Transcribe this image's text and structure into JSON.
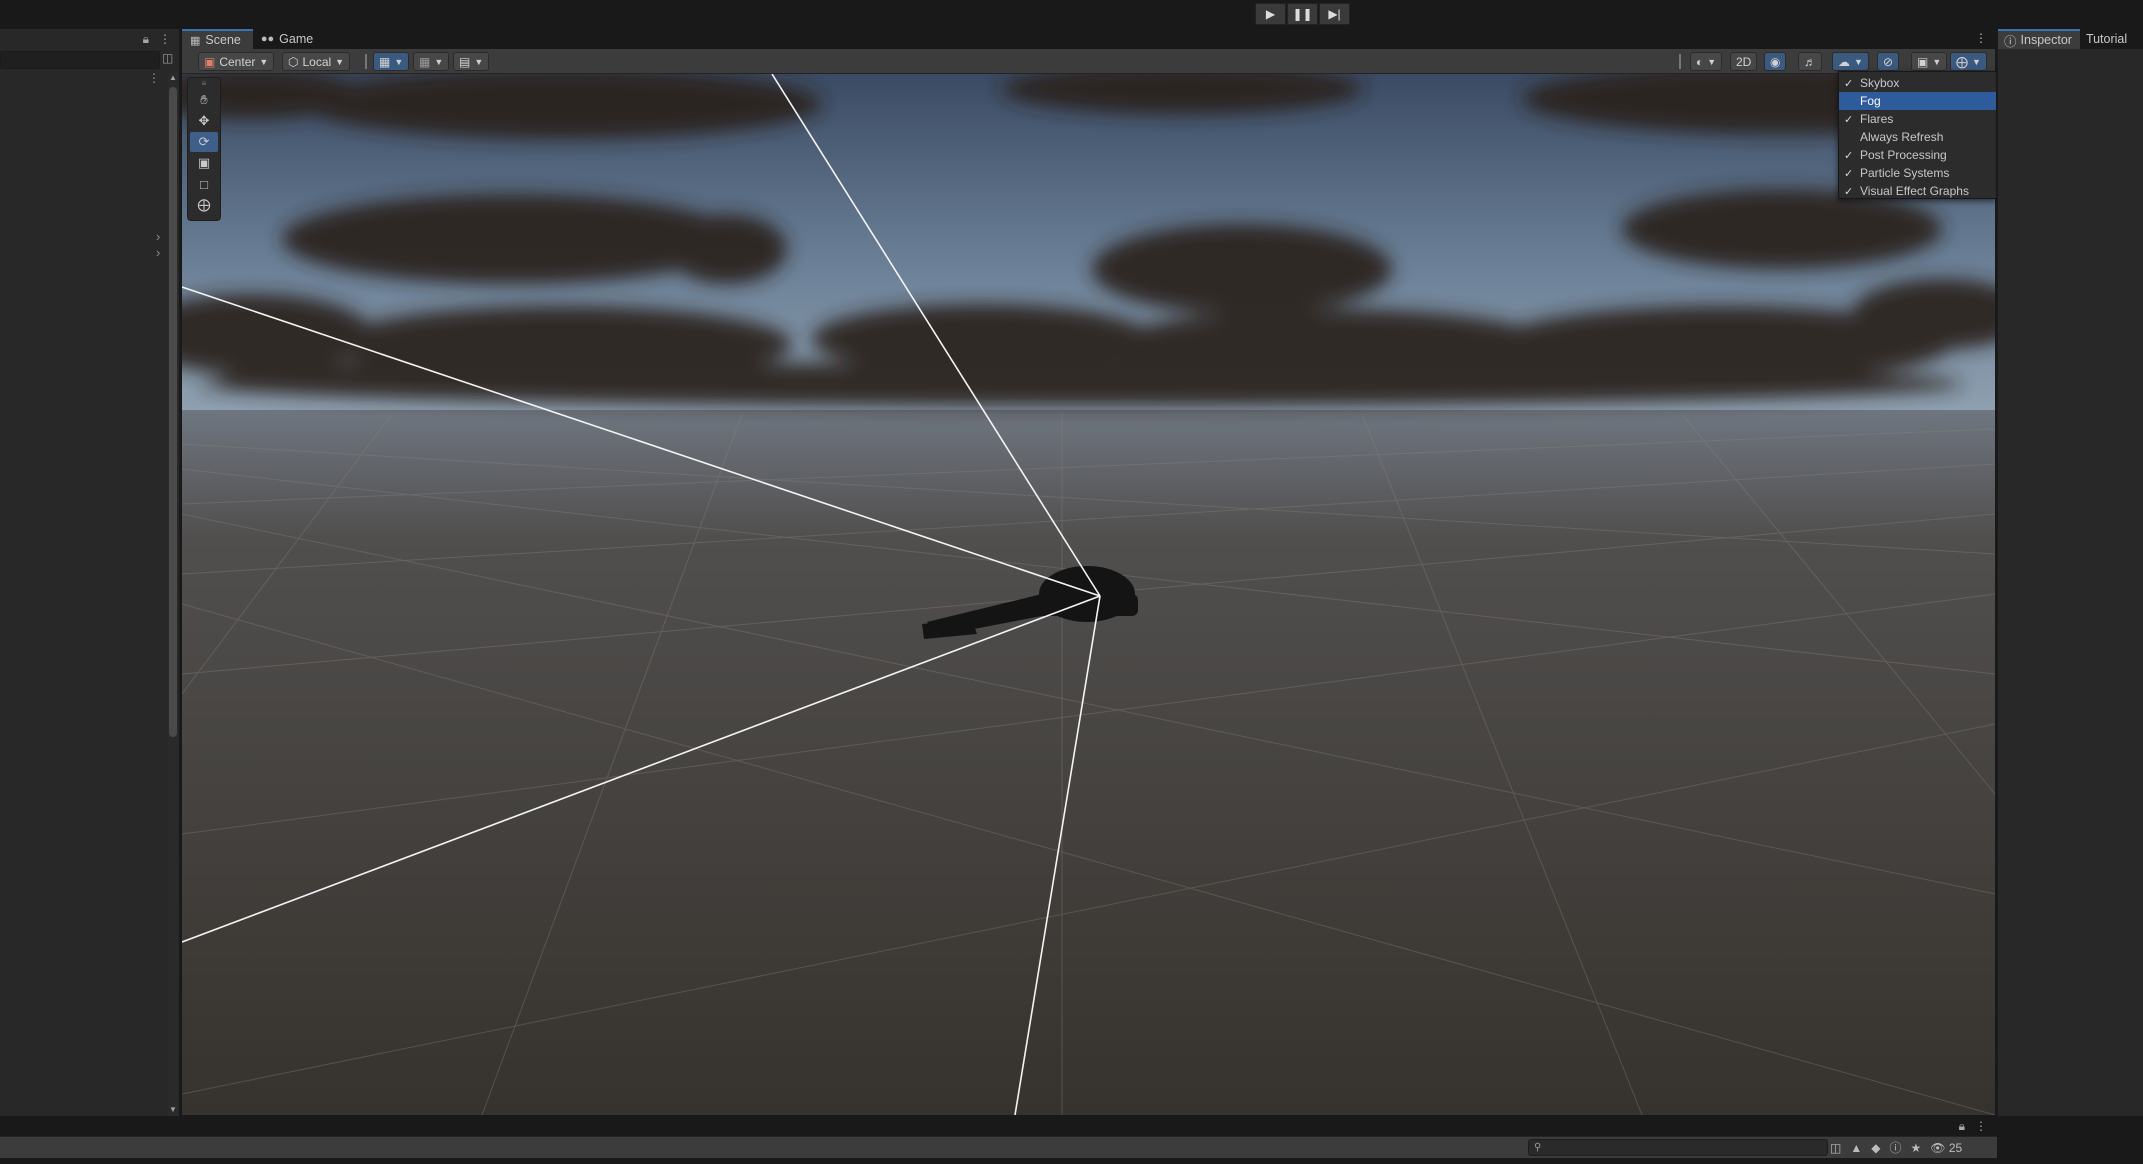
{
  "toolbar": {
    "play_icon": "play-icon",
    "pause_icon": "pause-icon",
    "step_icon": "step-icon"
  },
  "scene_tabs": [
    {
      "label": "Scene",
      "icon": "grid-icon"
    },
    {
      "label": "Game",
      "icon": "gamepad-icon"
    }
  ],
  "scene_toolbar": {
    "pivot_mode": "Center",
    "pivot_rotation": "Local",
    "mode_2d": "2D"
  },
  "tools": [
    "hand-tool",
    "move-tool",
    "rotate-tool",
    "scale-tool",
    "rect-tool",
    "transform-tool"
  ],
  "active_tool": "rotate-tool",
  "effects_menu": {
    "items": [
      {
        "label": "Skybox",
        "checked": true,
        "selected": false
      },
      {
        "label": "Fog",
        "checked": false,
        "selected": true
      },
      {
        "label": "Flares",
        "checked": true,
        "selected": false
      },
      {
        "label": "Always Refresh",
        "checked": false,
        "selected": false
      },
      {
        "label": "Post Processing",
        "checked": true,
        "selected": false
      },
      {
        "label": "Particle Systems",
        "checked": true,
        "selected": false
      },
      {
        "label": "Visual Effect Graphs",
        "checked": true,
        "selected": false
      }
    ]
  },
  "right_tabs": [
    {
      "label": "Inspector",
      "icon": "info-icon"
    },
    {
      "label": "Tutorial",
      "icon": ""
    }
  ],
  "console": {
    "search_icon": "search-icon",
    "visibility_count": "25"
  },
  "colors": {
    "accent": "#2d5b9c",
    "panel": "#282828",
    "toolbar": "#3c3c3c"
  }
}
